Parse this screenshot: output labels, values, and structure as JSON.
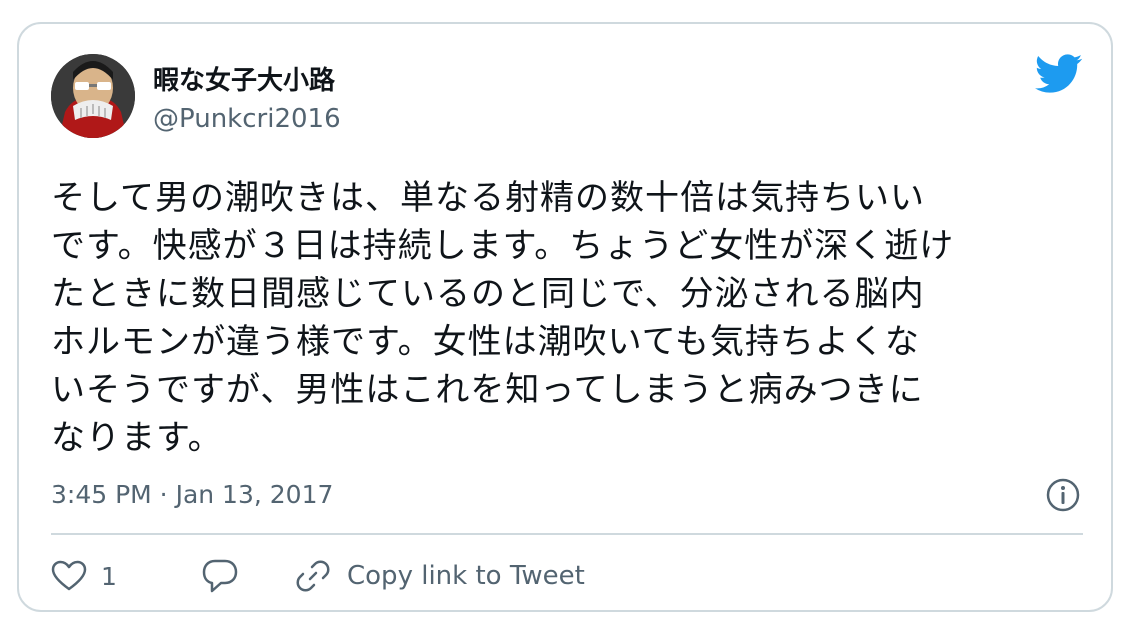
{
  "tweet": {
    "author_name": "暇な女子大小路",
    "handle": "@Punkcri2016",
    "text": "そして男の潮吹きは、単なる射精の数十倍は気持ちいい\nです。快感が３日は持続します。ちょうど女性が深く逝け\nたときに数日間感じているのと同じで、分泌される脳内\nホルモンが違う様です。女性は潮吹いても気持ちよくな\nいそうですが、男性はこれを知ってしまうと病みつきに\nなります。",
    "timestamp": "3:45 PM · Jan 13, 2017",
    "like_count": "1",
    "copy_link_label": "Copy link to Tweet"
  },
  "icons": {
    "brand": "twitter-bird-icon",
    "info": "info-icon",
    "like": "heart-icon",
    "reply": "reply-bubble-icon",
    "link": "link-icon"
  },
  "colors": {
    "brand_blue": "#1d9bf0",
    "text_primary": "#0f1419",
    "text_secondary": "#536471",
    "border": "#cfd9de"
  }
}
